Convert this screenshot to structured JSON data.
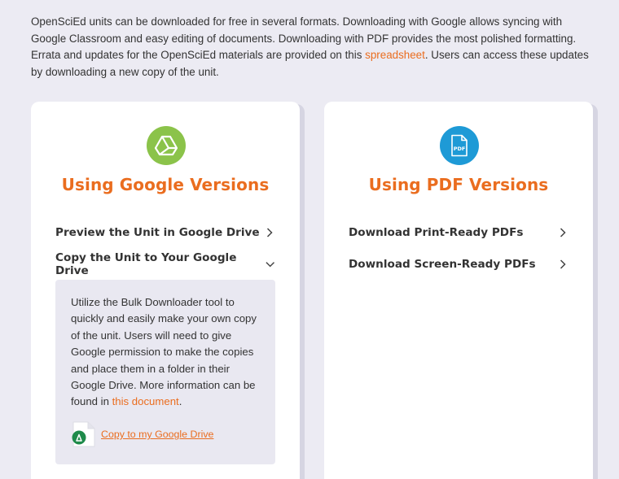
{
  "intro": {
    "text_before": "OpenSciEd units can be downloaded for free in several formats. Downloading with Google allows syncing with Google Classroom and easy editing of documents. Downloading with PDF provides the most polished formatting. Errata and updates for the OpenSciEd materials are provided on this ",
    "link_text": "spreadsheet",
    "text_after": ". Users can access these updates by downloading a new copy of the unit."
  },
  "google_card": {
    "icon": "google-drive-icon",
    "title": "Using Google Versions",
    "items": [
      {
        "label": "Preview the Unit in Google Drive",
        "state": "collapsed"
      },
      {
        "label": "Copy the Unit to Your Google Drive",
        "state": "expanded"
      }
    ],
    "panel": {
      "text_before": "Utilize the Bulk Downloader tool to quickly and easily make your own copy of the unit. Users will need to give Google permission to make the copies and place them in a folder in their Google Drive. More information can be found in ",
      "link_text": "this document",
      "text_after": ".",
      "copy_link": "Copy to my Google Drive",
      "copy_icon": "google-drive-doc-icon"
    }
  },
  "pdf_card": {
    "icon": "pdf-file-icon",
    "title": "Using PDF Versions",
    "items": [
      {
        "label": "Download Print-Ready PDFs",
        "state": "collapsed"
      },
      {
        "label": "Download Screen-Ready PDFs",
        "state": "collapsed"
      }
    ],
    "pdf_icon_text": "PDF"
  },
  "colors": {
    "accent": "#ea6d1f",
    "google_green": "#8bc34a",
    "pdf_blue": "#1e9ad6",
    "page_background": "#ecebf3",
    "panel_background": "#e9e8f1"
  }
}
